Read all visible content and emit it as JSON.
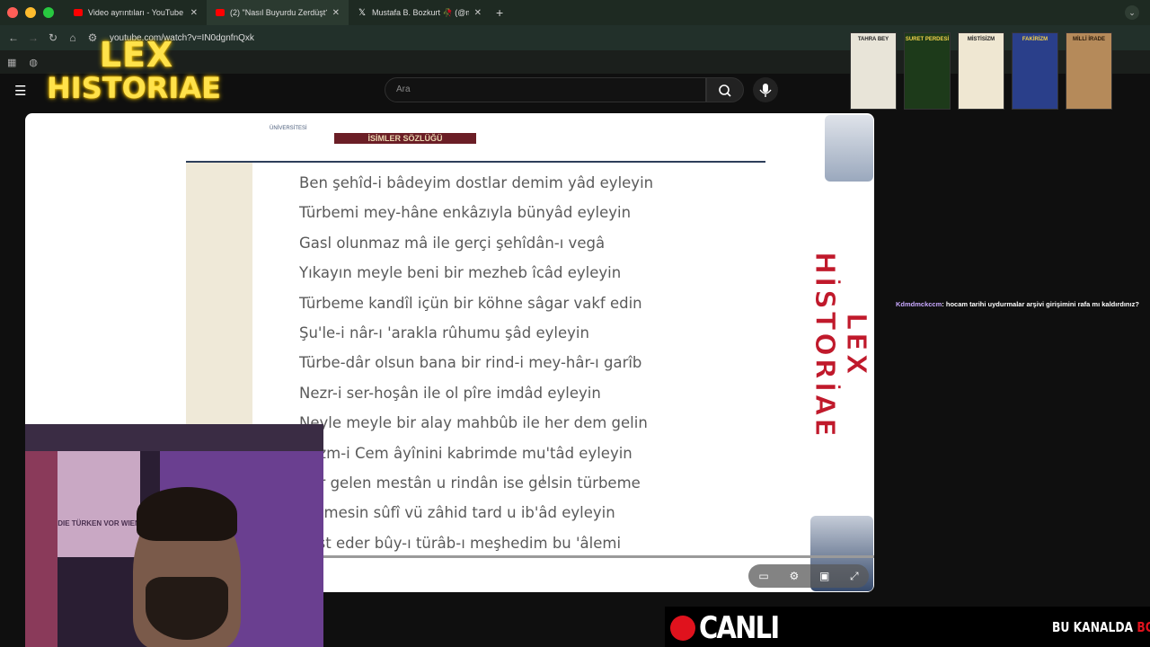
{
  "browser": {
    "tabs": [
      {
        "label": "Video ayrıntıları - YouTube St",
        "active": false,
        "icon": "youtube-icon"
      },
      {
        "label": "(2) \"Nasıl Buyurdu Zerdüşt?\"",
        "active": true,
        "icon": "youtube-icon"
      },
      {
        "label": "Mustafa B. Bozkurt 🥀 (@mu",
        "active": false,
        "icon": "x-icon"
      }
    ],
    "new_tab": "+",
    "url": "youtube.com/watch?v=IN0dgnfnQxk"
  },
  "youtube": {
    "search_placeholder": "Ara"
  },
  "overlay": {
    "logo_line1": "LEX",
    "logo_line2": "HISTORIAE",
    "side_title": "LEX HİSTORİAE"
  },
  "books": [
    {
      "title": "TAHRA BEY",
      "bg": "#e8e4d8",
      "fg": "#222"
    },
    {
      "title": "SURET PERDESİ",
      "bg": "#1d3a1a",
      "fg": "#f2d34a"
    },
    {
      "title": "MİSTİSİZM",
      "bg": "#efe7d2",
      "fg": "#222"
    },
    {
      "title": "FAKİRİZM",
      "bg": "#2a3f8a",
      "fg": "#f4d14a"
    },
    {
      "title": "MİLLİ İRADE",
      "bg": "#b58a5a",
      "fg": "#2a1a0a"
    }
  ],
  "document": {
    "header_small": "ÜNİVERSİTESİ",
    "title_band": "İSİMLER SÖZLÜĞÜ",
    "poem_lines": [
      "Ben şehîd-i bâdeyim dostlar demim yâd eyleyin",
      "Türbemi mey-hâne enkâzıyla bünyâd eyleyin",
      "Gasl olunmaz mâ ile gerçi şehîdân-ı vegâ",
      "Yıkayın meyle beni bir mezheb îcâd eyleyin",
      "Türbeme kandîl içün bir köhne sâgar vakf edin",
      "Şu'le-i nâr-ı 'arakla rûhumu şâd eyleyin",
      "Türbe-dâr olsun bana bir rind-i mey-hâr-ı garîb",
      "Nezr-i ser-hoşân ile ol pîre imdâd eyleyin",
      "Neyle meyle bir alay mahbûb ile her dem gelin",
      "Bezm-i Cem âyînini kabrimde mu'tâd eyleyin",
      "Her gelen mestân u rindân ise gelsin türbeme",
      "Gelmesin sûfî vü zâhid tard u ib'âd eyleyin",
      "Kast eder bûy-ı türâb-ı meşhedim bu 'âlemi"
    ]
  },
  "player_controls": [
    "subtitles-icon",
    "settings-icon",
    "theater-icon",
    "fullscreen-icon"
  ],
  "chat": {
    "user": "Kdmdmckccm",
    "message": ": hocam tarihi uydurmalar arşivi girişimini rafa mı kaldırdınız?"
  },
  "live": {
    "label": "CANLI",
    "ticker_white": "BU KANALDA ",
    "ticker_red": "BOŞ M"
  },
  "webcam": {
    "poster_text": "DIE TÜRKEN VOR WIEN"
  },
  "colors": {
    "accent_red": "#e0121d",
    "logo_yellow": "#ffe24a",
    "title_band": "#6b1e26"
  }
}
